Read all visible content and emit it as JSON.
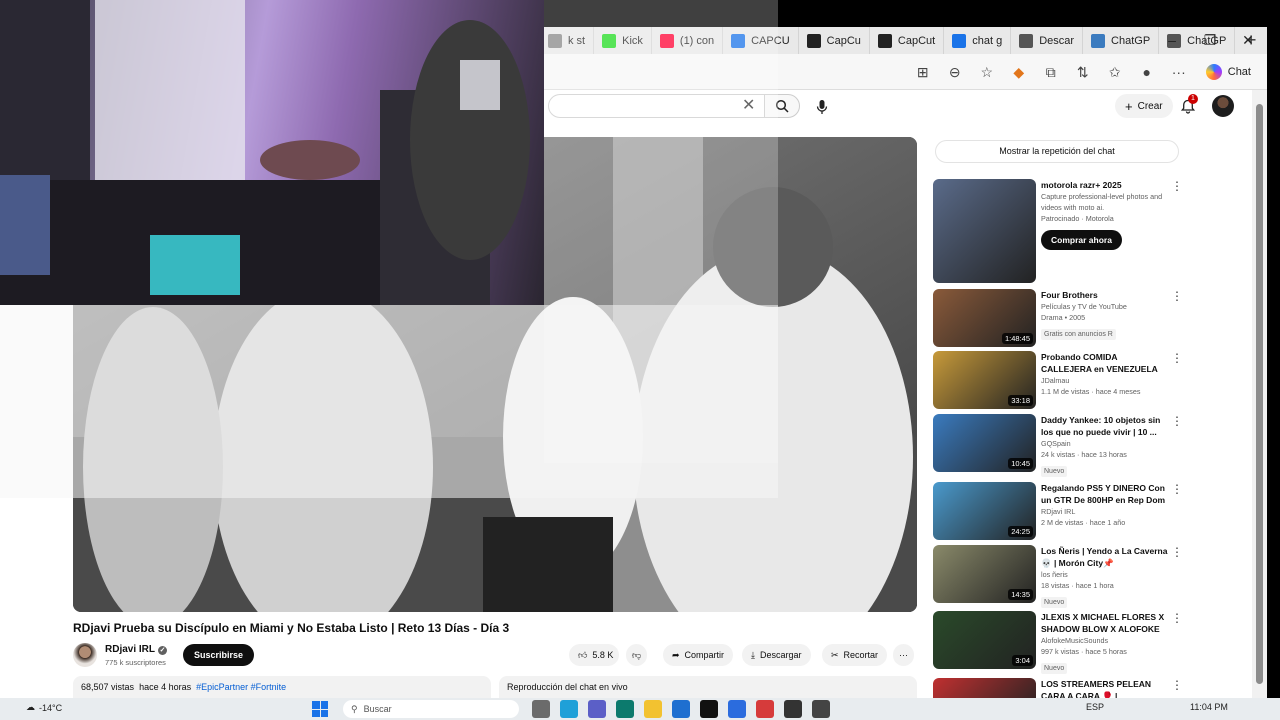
{
  "browser": {
    "tabs": [
      {
        "label": "k st",
        "icon": "tab-icon",
        "color": "#888888"
      },
      {
        "label": "Kick",
        "icon": "kick-icon",
        "color": "#1fdb1f"
      },
      {
        "label": "(1) con",
        "icon": "youtube-icon",
        "color": "#ff0033"
      },
      {
        "label": "CAPCU",
        "icon": "search-icon",
        "color": "#1a73e8"
      },
      {
        "label": "CapCu",
        "icon": "capcut-icon",
        "color": "#222222"
      },
      {
        "label": "CapCut",
        "icon": "capcut-icon",
        "color": "#222222"
      },
      {
        "label": "chat g",
        "icon": "search-icon",
        "color": "#1a73e8"
      },
      {
        "label": "Descar",
        "icon": "chatgpt-icon",
        "color": "#555555"
      },
      {
        "label": "ChatGP",
        "icon": "chatgpt-icon",
        "color": "#3b7bbf"
      },
      {
        "label": "ChatGP",
        "icon": "chatgpt-icon",
        "color": "#555555"
      }
    ],
    "copilot_label": "Chat"
  },
  "youtube": {
    "create_label": "Crear",
    "notification_count": "1",
    "video": {
      "title": "RDjavi Prueba su Discípulo en Miami y No Estaba Listo | Reto 13 Días - Día 3",
      "channel": "RDjavi IRL",
      "subscribers": "775 k suscriptores",
      "subscribe_label": "Suscribirse",
      "likes": "5.8 K",
      "share_label": "Compartir",
      "download_label": "Descargar",
      "clip_label": "Recortar",
      "views": "68,507 vistas",
      "age": "hace 4 horas",
      "tags": "#EpicPartner #Fortnite",
      "chat_replay_label": "Reproducción del chat en vivo"
    },
    "show_chat_label": "Mostrar la repetición del chat",
    "recommendations": [
      {
        "title": "motorola razr+ 2025",
        "line1": "Capture professional-level photos and videos with moto ai.",
        "line2": "Patrocinado · Motorola",
        "cta": "Comprar ahora",
        "duration": "",
        "badge": "",
        "thumb_color": "#5a6b8a"
      },
      {
        "title": "Four Brothers",
        "line1": "Películas y TV de YouTube",
        "line2": "Drama • 2005",
        "badge": "Gratis con anuncios  R",
        "duration": "1:48:45",
        "thumb_color": "#8a5a3a"
      },
      {
        "title": "Probando COMIDA CALLEJERA en VENEZUELA 🍗 ve | Platos ...",
        "line1": "JDalmau",
        "line2": "1.1 M de vistas · hace 4 meses",
        "badge": "",
        "duration": "33:18",
        "thumb_color": "#c79a3a"
      },
      {
        "title": "Daddy Yankee: 10 objetos sin los que no puede vivir | 10 ...",
        "line1": "GQSpain",
        "line2": "24 k vistas · hace 13 horas",
        "badge": "Nuevo",
        "duration": "10:45",
        "thumb_color": "#3a7bbf"
      },
      {
        "title": "Regalando PS5 Y DINERO Con un GTR De 800HP en Rep Dom",
        "line1": "RDjavi IRL",
        "line2": "2 M de vistas · hace 1 año",
        "badge": "",
        "duration": "24:25",
        "thumb_color": "#4a9acd"
      },
      {
        "title": "Los Ñeris | Yendo a La Caverna 💀 | Morón City📌",
        "line1": "los ñeris",
        "line2": "18 vistas · hace 1 hora",
        "badge": "Nuevo",
        "duration": "14:35",
        "thumb_color": "#8a8a6a"
      },
      {
        "title": "JLEXIS X MICHAEL FLORES X SHADOW BLOW X ALOFOKE ...",
        "line1": "AlofokeMusicSounds",
        "line2": "997 k vistas · hace 5 horas",
        "badge": "Nuevo",
        "duration": "3:04",
        "thumb_color": "#2a4a2a"
      },
      {
        "title": "LOS STREAMERS PELEAN CARA A CARA 🥊 |",
        "line1": "",
        "line2": "",
        "badge": "",
        "duration": "",
        "thumb_color": "#c03030"
      }
    ]
  },
  "taskbar": {
    "temperature": "-14°C",
    "search_placeholder": "Buscar",
    "language": "ESP",
    "time": "11:04 PM"
  }
}
